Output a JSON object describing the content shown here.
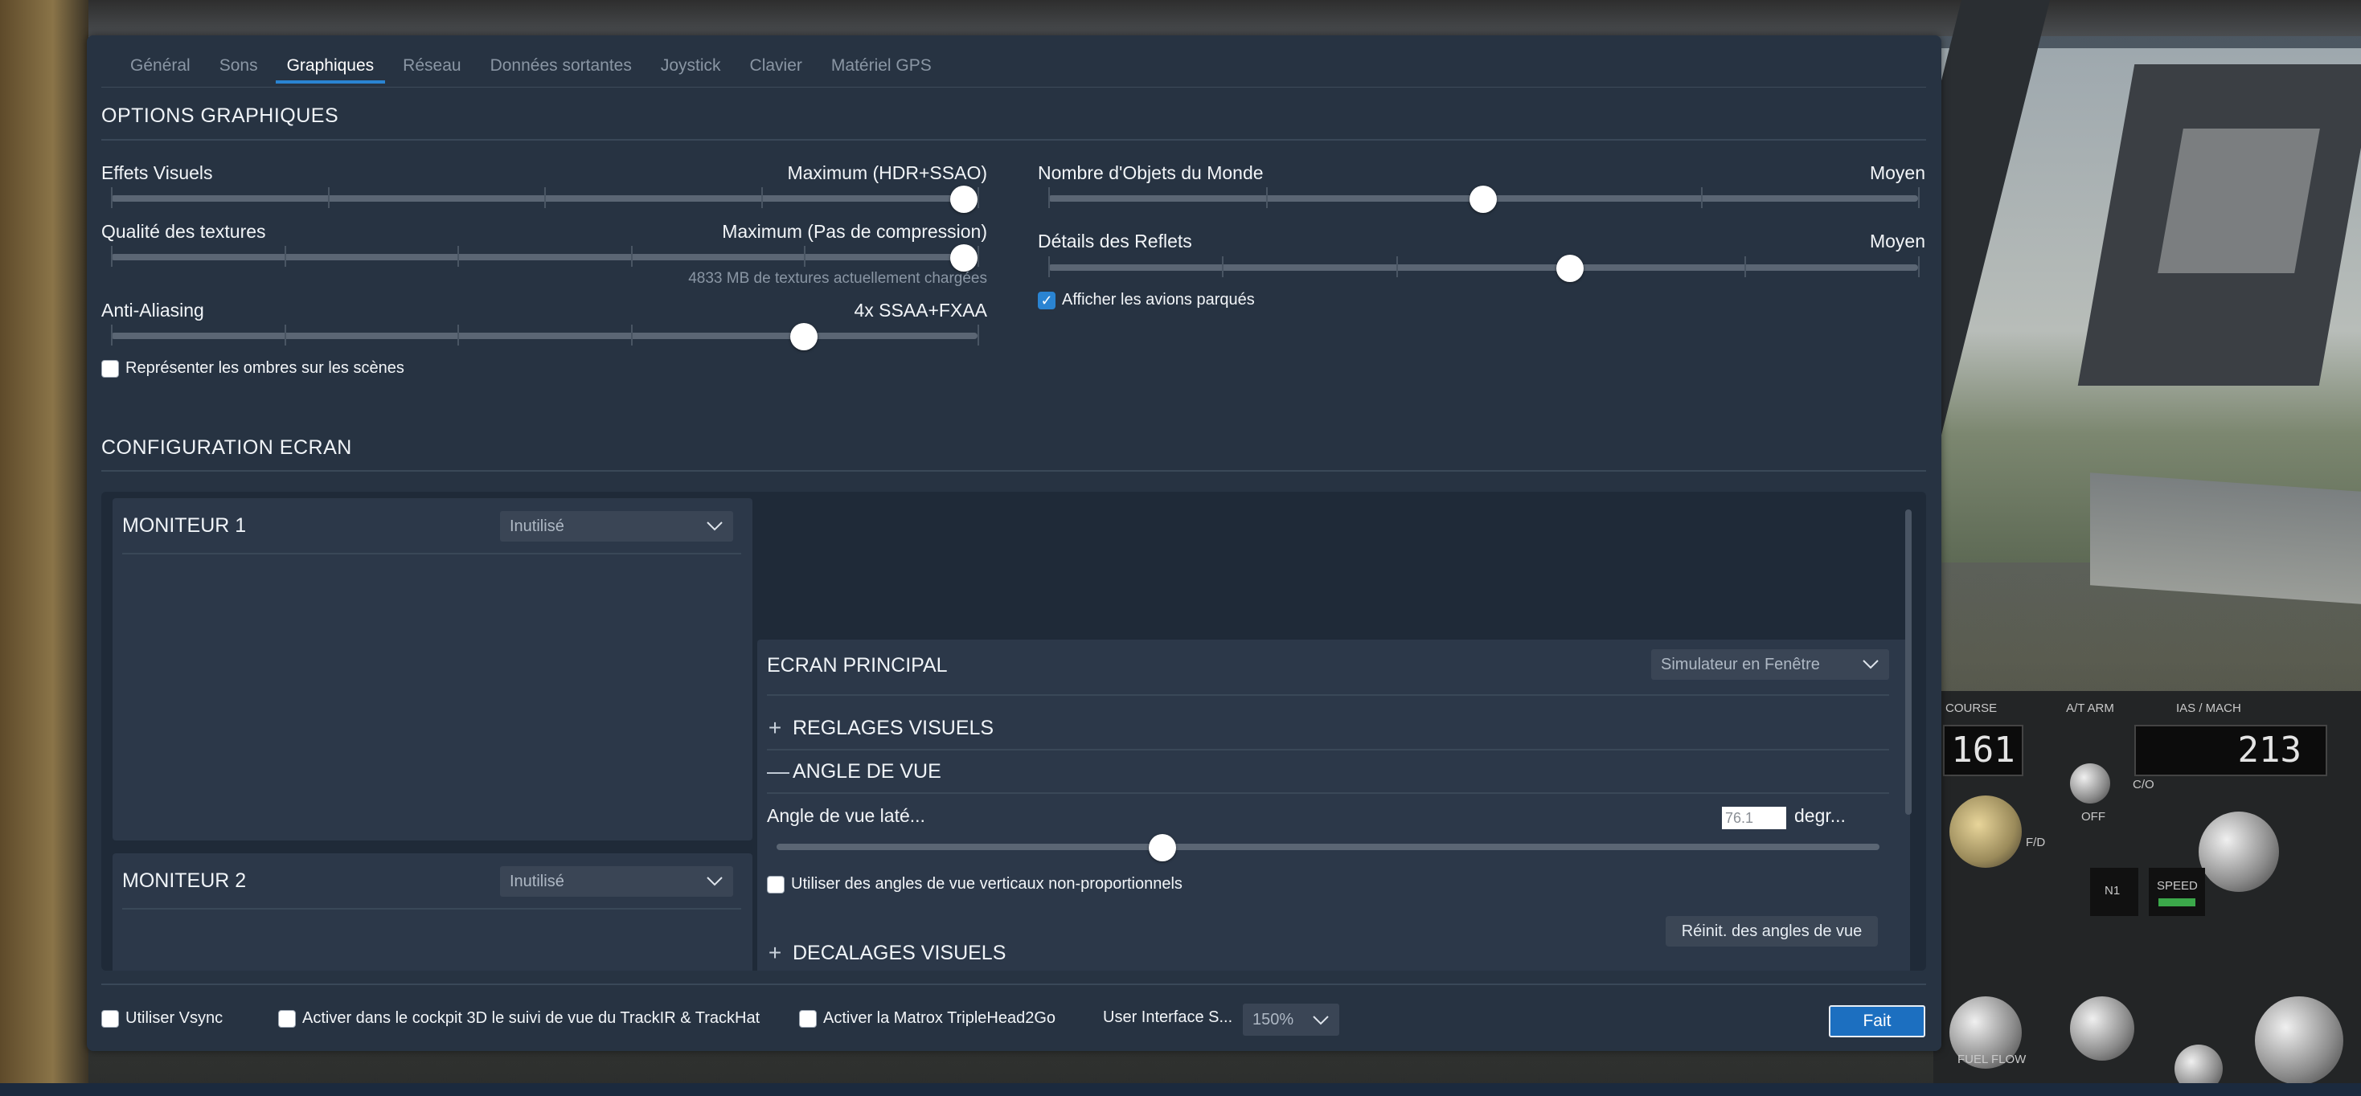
{
  "tabs": [
    {
      "label": "Général"
    },
    {
      "label": "Sons"
    },
    {
      "label": "Graphiques"
    },
    {
      "label": "Réseau"
    },
    {
      "label": "Données sortantes"
    },
    {
      "label": "Joystick"
    },
    {
      "label": "Clavier"
    },
    {
      "label": "Matériel GPS"
    }
  ],
  "active_tab": "Graphiques",
  "graphics": {
    "title": "OPTIONS GRAPHIQUES",
    "visual_effects": {
      "label": "Effets Visuels",
      "value": "Maximum (HDR+SSAO)",
      "level": 1.0
    },
    "texture_quality": {
      "label": "Qualité des textures",
      "value": "Maximum (Pas de compression)",
      "level": 1.0,
      "sub": "4833 MB de textures actuellement chargées"
    },
    "anti_aliasing": {
      "label": "Anti-Aliasing",
      "value": "4x SSAA+FXAA",
      "level": 0.8
    },
    "shadows_checkbox": {
      "label": "Représenter les ombres sur les scènes",
      "checked": false
    },
    "world_objects": {
      "label": "Nombre d'Objets du Monde",
      "value": "Moyen",
      "level": 0.5
    },
    "reflection_detail": {
      "label": "Détails des Reflets",
      "value": "Moyen",
      "level": 0.6
    },
    "parked_aircraft_checkbox": {
      "label": "Afficher les avions parqués",
      "checked": true
    }
  },
  "screen": {
    "title": "CONFIGURATION ECRAN",
    "monitor1": {
      "title": "MONITEUR 1",
      "dropdown": "Inutilisé"
    },
    "monitor2": {
      "title": "MONITEUR 2",
      "dropdown": "Inutilisé"
    },
    "main": {
      "title": "ECRAN PRINCIPAL",
      "dropdown": "Simulateur en Fenêtre",
      "visual_settings": "REGLAGES VISUELS",
      "view_angle": "ANGLE DE VUE",
      "lateral_fov_label": "Angle de vue laté...",
      "lateral_fov_value": "76.1",
      "lateral_fov_unit": "degr...",
      "lateral_fov_level": 0.35,
      "nonprop_checkbox": {
        "label": "Utiliser des angles de vue verticaux non-proportionnels",
        "checked": false
      },
      "reset_button": "Réinit. des angles de vue",
      "visual_offsets": "DECALAGES VISUELS"
    }
  },
  "footer": {
    "vsync": {
      "label": "Utiliser Vsync",
      "checked": false
    },
    "trackir": {
      "label": "Activer dans le cockpit 3D le suivi de vue du TrackIR & TrackHat",
      "checked": false
    },
    "matrox": {
      "label": "Activer la Matrox TripleHead2Go",
      "checked": false
    },
    "ui_scale_label": "User Interface S...",
    "ui_scale_value": "150%",
    "done_button": "Fait"
  },
  "cockpit": {
    "course_label": "COURSE",
    "course_value": "161",
    "ias_label": "IAS / MACH",
    "ias_value": "213",
    "at_arm": "A/T ARM",
    "off": "OFF",
    "co": "C/O",
    "n1": "N1",
    "speed": "SPEED",
    "fuel_flow": "FUEL FLOW",
    "fd": "F/D"
  },
  "colors": {
    "accent": "#2a84d2",
    "dialog_bg": "#273342",
    "done_button": "#1c6fc0"
  }
}
